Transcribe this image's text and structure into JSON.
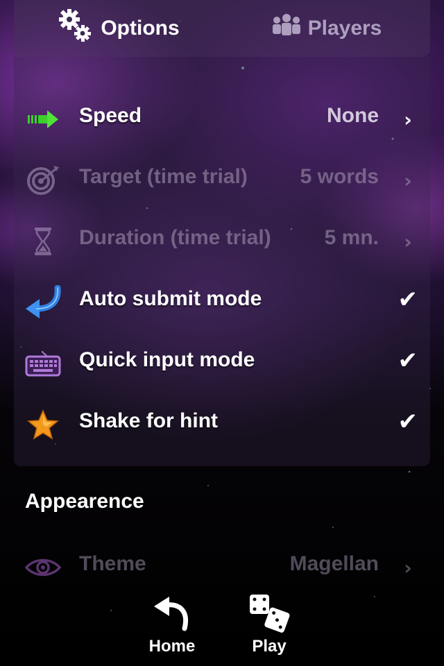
{
  "tabs": [
    {
      "label": "Options",
      "icon": "gears-icon",
      "active": true
    },
    {
      "label": "Players",
      "icon": "people-icon",
      "active": false
    }
  ],
  "settings": [
    {
      "label": "Speed",
      "value": "None",
      "icon": "arrow-right-icon",
      "control": "chevron",
      "enabled": true
    },
    {
      "label": "Target (time trial)",
      "value": "5 words",
      "icon": "target-icon",
      "control": "chevron",
      "enabled": false
    },
    {
      "label": "Duration (time trial)",
      "value": "5 mn.",
      "icon": "hourglass-icon",
      "control": "chevron",
      "enabled": false
    },
    {
      "label": "Auto submit mode",
      "checked": true,
      "check_glyph": "✔",
      "icon": "return-arrow-icon",
      "control": "check",
      "enabled": true
    },
    {
      "label": "Quick input mode",
      "checked": true,
      "check_glyph": "✔",
      "icon": "keyboard-icon",
      "control": "check",
      "enabled": true
    },
    {
      "label": "Shake for hint",
      "checked": true,
      "check_glyph": "✔",
      "icon": "star-icon",
      "control": "check",
      "enabled": true
    }
  ],
  "appearance": {
    "section_title": "Appearence",
    "theme": {
      "label": "Theme",
      "value": "Magellan",
      "icon": "eye-icon",
      "control": "chevron"
    }
  },
  "bottom_nav": {
    "home_label": "Home",
    "play_label": "Play"
  },
  "chevron_glyph": "›",
  "colors": {
    "accent_green": "#3ccf2a",
    "accent_blue": "#2f7fe0",
    "star_orange": "#f39a1c",
    "keyboard_violet": "#b07ad8"
  }
}
